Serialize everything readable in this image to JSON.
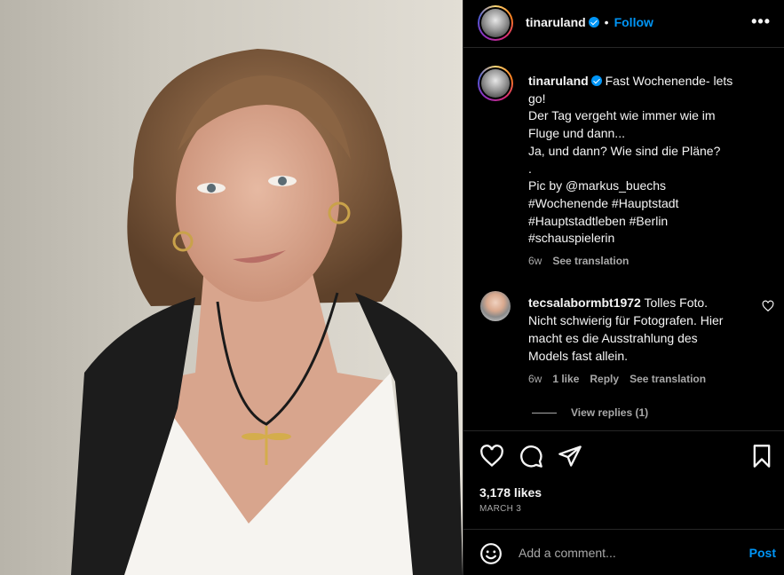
{
  "post": {
    "username": "tinaruland",
    "follow_label": "Follow",
    "more_icon": "more-horizontal-icon"
  },
  "caption": {
    "username": "tinaruland",
    "lines": [
      "Fast Wochenende- lets",
      "go!",
      "Der Tag vergeht wie immer wie im",
      "Fluge und dann...",
      "Ja, und dann? Wie sind die Pläne?",
      ".",
      "Pic by @markus_buechs",
      "#Wochenende #Hauptstadt",
      "#Hauptstadtleben #Berlin",
      "#schauspielerin"
    ],
    "age": "6w",
    "see_translation": "See translation"
  },
  "comment": {
    "username": "tecsalabormbt1972",
    "lines": [
      "Tolles Foto.",
      "Nicht schwierig für Fotografen. Hier",
      "macht es die Ausstrahlung des",
      "Models fast allein."
    ],
    "age": "6w",
    "likes": "1 like",
    "reply": "Reply",
    "see_translation": "See translation",
    "view_replies": "View replies (1)"
  },
  "actions": {
    "likes": "3,178 likes",
    "date": "MARCH 3"
  },
  "add_comment": {
    "placeholder": "Add a comment...",
    "post_label": "Post"
  },
  "colors": {
    "accent": "#0095f6",
    "background": "#000000",
    "muted": "#a8a8a8"
  }
}
